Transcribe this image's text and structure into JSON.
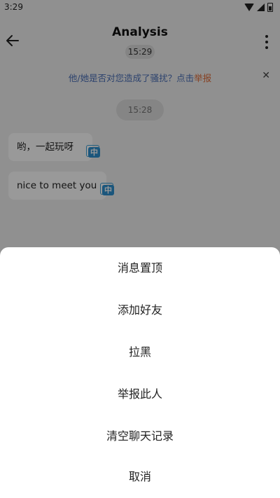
{
  "status_bar": {
    "time": "3:29"
  },
  "header": {
    "title": "Analysis",
    "subtitle_time": "15:29"
  },
  "banner": {
    "text_prefix": "他/她是否对您造成了骚扰？点击",
    "report_link": "举报",
    "close_icon": "close-icon"
  },
  "chat": {
    "timestamp": "15:28",
    "messages": [
      {
        "text": "哟，一起玩呀",
        "translate_icon": "中"
      },
      {
        "text": "nice to meet you",
        "translate_icon": "中"
      }
    ]
  },
  "sheet": {
    "items": [
      {
        "label": "消息置顶"
      },
      {
        "label": "添加好友"
      },
      {
        "label": "拉黑"
      },
      {
        "label": "举报此人"
      },
      {
        "label": "清空聊天记录"
      },
      {
        "label": "取消"
      }
    ]
  },
  "colors": {
    "accent_link": "#4a6fb7",
    "report": "#e06d3a",
    "translate_icon": "#2e8fcf"
  }
}
